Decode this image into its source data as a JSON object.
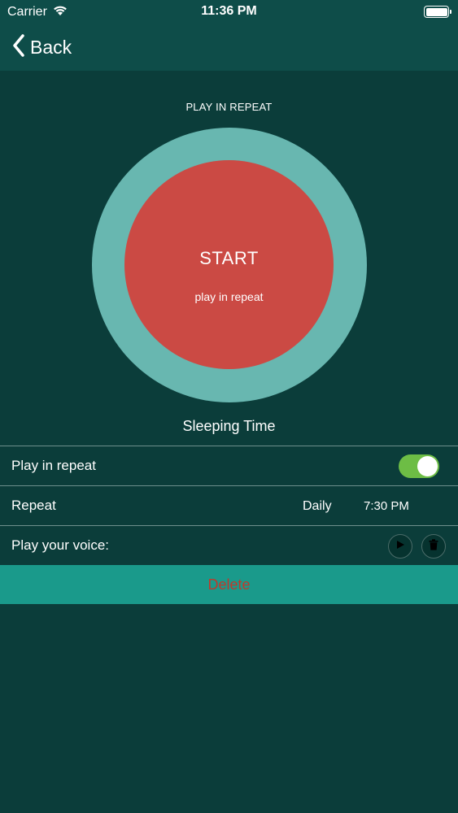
{
  "status_bar": {
    "carrier": "Carrier",
    "time": "11:36 PM"
  },
  "nav": {
    "back_label": "Back"
  },
  "repeat_section": {
    "title": "PLAY IN REPEAT",
    "start_label": "START",
    "start_sublabel": "play in repeat"
  },
  "sleeping_time": {
    "title": "Sleeping Time"
  },
  "settings": {
    "play_in_repeat": {
      "label": "Play in repeat",
      "enabled": true
    },
    "repeat": {
      "label": "Repeat",
      "frequency": "Daily",
      "time": "7:30 PM"
    },
    "play_voice": {
      "label": "Play your voice:",
      "play_icon": "play-icon",
      "delete_icon": "trash-icon"
    }
  },
  "delete_button": {
    "label": "Delete"
  },
  "colors": {
    "background": "#0b3d3a",
    "bar": "#0e4d49",
    "ring": "#68b7b0",
    "start": "#cb4a44",
    "toggle_on": "#6dbd45",
    "delete_bg": "#1a9a8b",
    "delete_text": "#c0392b"
  }
}
